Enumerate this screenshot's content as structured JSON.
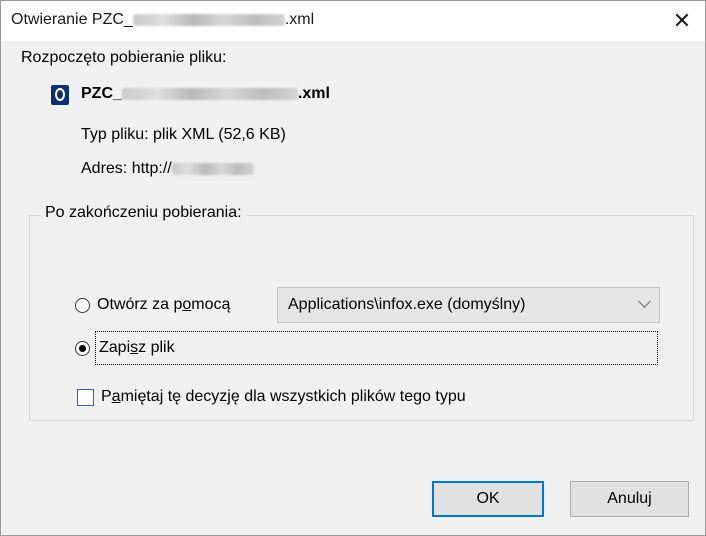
{
  "dialog": {
    "title_prefix": "Otwieranie PZC_",
    "title_suffix": ".xml",
    "close_symbol": "✕",
    "intro": "Rozpoczęto pobieranie pliku:",
    "file": {
      "icon": "xml-document-icon",
      "name_prefix": "PZC_",
      "name_suffix": ".xml",
      "type": "Typ pliku:  plik XML (52,6 KB)",
      "address": "Adres:  http://"
    },
    "after_download": {
      "group_label": "Po zakończeniu pobierania:",
      "open_with": {
        "label_pre": "Otwórz za p",
        "label_mnemonic": "o",
        "label_post": "mocą",
        "selected": false,
        "application": "Applications\\infox.exe (domyślny)"
      },
      "save": {
        "label_pre": "Zapi",
        "label_mnemonic": "s",
        "label_post": "z plik",
        "selected": true
      },
      "remember": {
        "label_pre": "P",
        "label_mnemonic": "a",
        "label_post": "miętaj tę decyzję dla wszystkich plików tego typu",
        "checked": false
      }
    },
    "buttons": {
      "ok": "OK",
      "cancel": "Anuluj"
    },
    "colors": {
      "accent": "#0078d7",
      "background": "#f0f0f0"
    }
  }
}
